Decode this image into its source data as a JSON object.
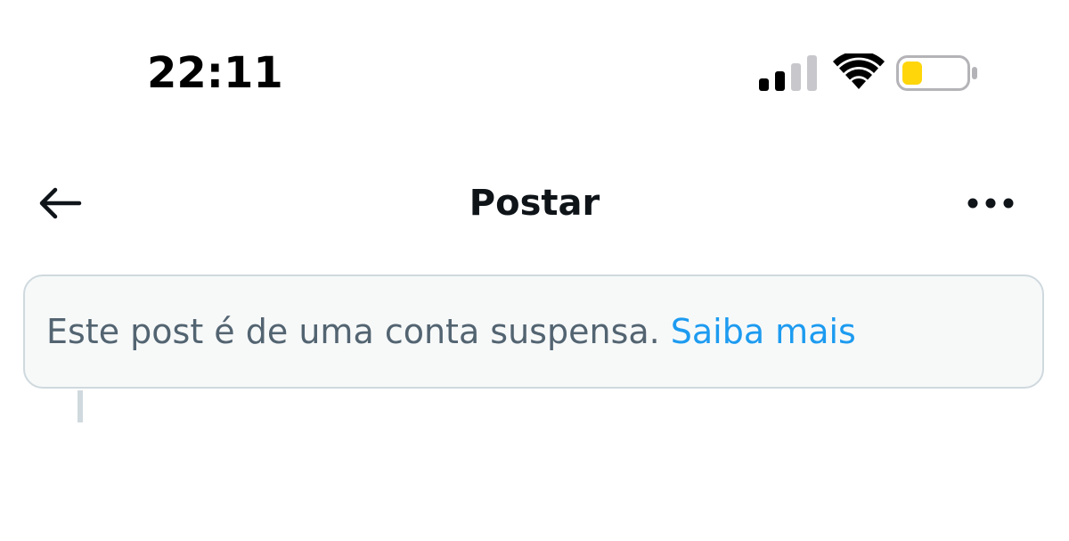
{
  "status_bar": {
    "time": "22:11",
    "icons": [
      "cellular-signal-icon",
      "wifi-icon",
      "battery-icon"
    ],
    "battery_color": "#ffd60a"
  },
  "header": {
    "title": "Postar",
    "back_icon": "arrow-left-icon",
    "more_icon": "more-dots-icon"
  },
  "notice": {
    "text": "Este post é de uma conta suspensa.",
    "link_label": "Saiba mais",
    "link_color": "#1d9bf0"
  }
}
